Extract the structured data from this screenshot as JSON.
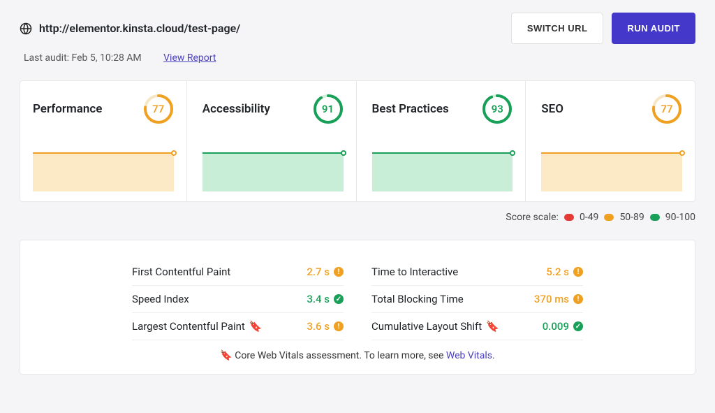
{
  "header": {
    "url": "http://elementor.kinsta.cloud/test-page/",
    "switch_label": "SWITCH URL",
    "run_label": "RUN AUDIT"
  },
  "sub": {
    "last_audit": "Last audit: Feb 5, 10:28 AM",
    "view_report": "View Report"
  },
  "cards": {
    "performance": {
      "title": "Performance",
      "score": "77"
    },
    "accessibility": {
      "title": "Accessibility",
      "score": "91"
    },
    "best_practices": {
      "title": "Best Practices",
      "score": "93"
    },
    "seo": {
      "title": "SEO",
      "score": "77"
    }
  },
  "scale": {
    "label": "Score scale:",
    "r1": "0-49",
    "r2": "50-89",
    "r3": "90-100"
  },
  "metrics": {
    "fcp": {
      "name": "First Contentful Paint",
      "value": "2.7 s"
    },
    "si": {
      "name": "Speed Index",
      "value": "3.4 s"
    },
    "lcp": {
      "name": "Largest Contentful Paint",
      "value": "3.6 s"
    },
    "tti": {
      "name": "Time to Interactive",
      "value": "5.2 s"
    },
    "tbt": {
      "name": "Total Blocking Time",
      "value": "370 ms"
    },
    "cls": {
      "name": "Cumulative Layout Shift",
      "value": "0.009"
    }
  },
  "footnote": {
    "text_a": "Core Web Vitals assessment. To learn more, see ",
    "link": "Web Vitals",
    "text_b": "."
  },
  "colors": {
    "orange": "#f0a020",
    "green": "#18a058"
  }
}
